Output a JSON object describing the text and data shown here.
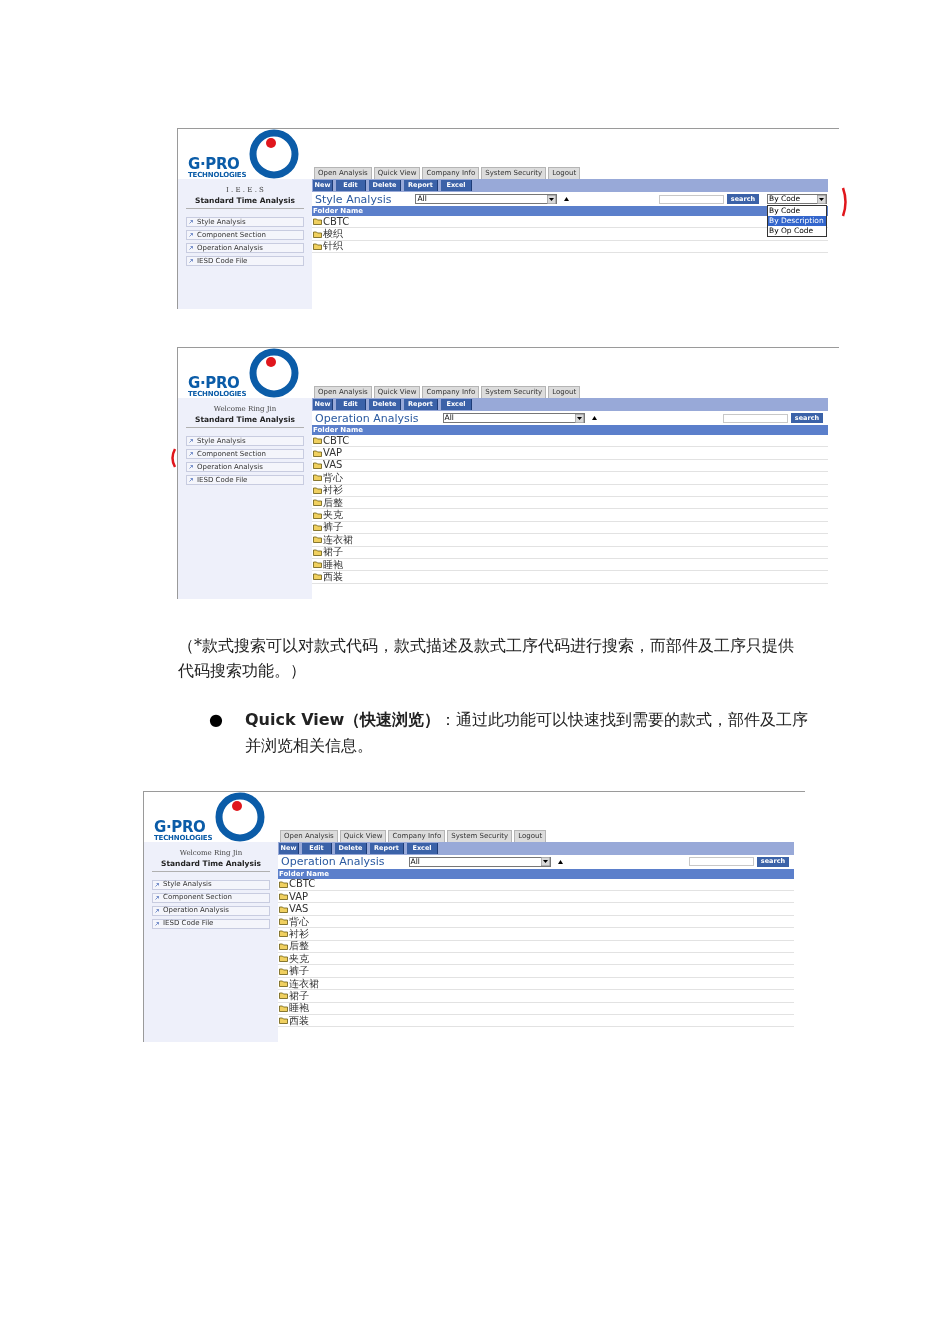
{
  "screenshots": [
    {
      "edge_mark_right": true,
      "sidebar": {
        "logo": {
          "name": "G·PRO",
          "tagline": "TECHNOLOGIES"
        },
        "welcome": "I . E . E . S",
        "title": "Standard Time Analysis",
        "items": [
          {
            "label": "Style Analysis"
          },
          {
            "label": "Component Section"
          },
          {
            "label": "Operation Analysis"
          },
          {
            "label": "IESD Code File"
          }
        ]
      },
      "tabs": [
        {
          "label": "Open Analysis"
        },
        {
          "label": "Quick View"
        },
        {
          "label": "Company Info"
        },
        {
          "label": "System Security"
        },
        {
          "label": "Logout"
        }
      ],
      "toolbar": [
        "New",
        "Edit",
        "Delete",
        "Report",
        "Excel"
      ],
      "heading": "Style Analysis",
      "filter": {
        "value": "All"
      },
      "search": {
        "button": "search"
      },
      "search_by": {
        "value": "By Code",
        "options": [
          {
            "label": "By Code",
            "highlighted": false
          },
          {
            "label": "By Description",
            "highlighted": true
          },
          {
            "label": "By Op Code",
            "highlighted": false
          }
        ]
      },
      "table": {
        "columns": [
          "Folder Name"
        ],
        "rows": [
          "CBTC",
          "梭织",
          "针织"
        ]
      }
    },
    {
      "edge_mark_left": true,
      "sidebar": {
        "logo": {
          "name": "G·PRO",
          "tagline": "TECHNOLOGIES"
        },
        "welcome": "Welcome Ring Jin",
        "title": "Standard Time Analysis",
        "items": [
          {
            "label": "Style Analysis"
          },
          {
            "label": "Component Section"
          },
          {
            "label": "Operation Analysis"
          },
          {
            "label": "IESD Code File"
          }
        ]
      },
      "tabs": [
        {
          "label": "Open Analysis"
        },
        {
          "label": "Quick View"
        },
        {
          "label": "Company Info"
        },
        {
          "label": "System Security"
        },
        {
          "label": "Logout"
        }
      ],
      "toolbar": [
        "New",
        "Edit",
        "Delete",
        "Report",
        "Excel"
      ],
      "heading": "Operation Analysis",
      "filter": {
        "value": "All"
      },
      "search": {
        "button": "search"
      },
      "table": {
        "columns": [
          "Folder Name"
        ],
        "rows": [
          "CBTC",
          "VAP",
          "VAS",
          "背心",
          "衬衫",
          "后整",
          "夹克",
          "裤子",
          "连衣裙",
          "裙子",
          "睡袍",
          "西装"
        ]
      }
    },
    {
      "sidebar": {
        "logo": {
          "name": "G·PRO",
          "tagline": "TECHNOLOGIES"
        },
        "welcome": "Welcome Ring Jin",
        "title": "Standard Time Analysis",
        "items": [
          {
            "label": "Style Analysis"
          },
          {
            "label": "Component Section"
          },
          {
            "label": "Operation Analysis"
          },
          {
            "label": "IESD Code File"
          }
        ]
      },
      "tabs": [
        {
          "label": "Open Analysis"
        },
        {
          "label": "Quick View"
        },
        {
          "label": "Company Info"
        },
        {
          "label": "System Security"
        },
        {
          "label": "Logout"
        }
      ],
      "toolbar": [
        "New",
        "Edit",
        "Delete",
        "Report",
        "Excel"
      ],
      "heading": "Operation Analysis",
      "filter": {
        "value": "All"
      },
      "search": {
        "button": "search"
      },
      "table": {
        "columns": [
          "Folder Name"
        ],
        "rows": [
          "CBTC",
          "VAP",
          "VAS",
          "背心",
          "衬衫",
          "后整",
          "夹克",
          "裤子",
          "连衣裙",
          "裙子",
          "睡袍",
          "西装"
        ]
      }
    }
  ],
  "note": "（*款式搜索可以对款式代码，款式描述及款式工序代码进行搜索，而部件及工序只提供代码搜索功能。）",
  "bullet": {
    "marker": "●",
    "text": "**Quick View（快速浏览）**：通过此功能可以快速找到需要的款式，部件及工序并浏览相关信息。"
  }
}
